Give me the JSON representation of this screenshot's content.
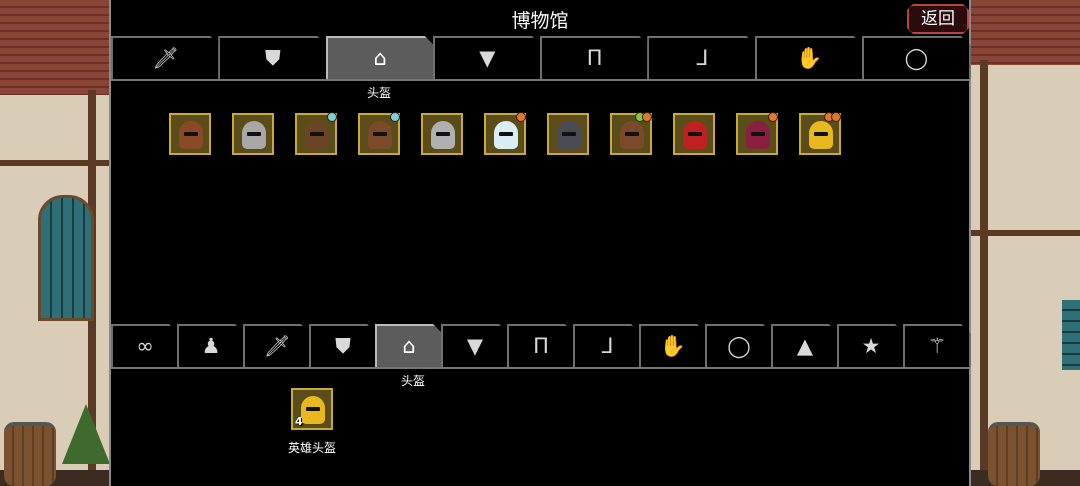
{
  "window": {
    "title": "博物馆",
    "back_label": "返回"
  },
  "top_tabs": {
    "tabs": [
      {
        "icon": "sword-icon",
        "glyph": "🗡"
      },
      {
        "icon": "shield-icon",
        "glyph": "⛊"
      },
      {
        "icon": "helmet-icon",
        "glyph": "⌂"
      },
      {
        "icon": "armor-icon",
        "glyph": "▼"
      },
      {
        "icon": "pants-icon",
        "glyph": "Π"
      },
      {
        "icon": "boots-icon",
        "glyph": "ᒧ"
      },
      {
        "icon": "glove-icon",
        "glyph": "✋"
      },
      {
        "icon": "ring-icon",
        "glyph": "◯"
      }
    ],
    "active_caption": "头盔"
  },
  "collection": {
    "items": [
      {
        "name": "leather-cap",
        "color": "#8a4a28",
        "badges": []
      },
      {
        "name": "iron-visor-helm",
        "color": "#a8a8a8",
        "badges": []
      },
      {
        "name": "bronze-horned-helm",
        "color": "#6b4426",
        "badges": [
          "#7ad0e0"
        ]
      },
      {
        "name": "fur-hood",
        "color": "#7a4a2a",
        "badges": [
          "#7ad0e0"
        ]
      },
      {
        "name": "steel-great-helm",
        "color": "#b0b0b0",
        "badges": []
      },
      {
        "name": "frost-helm",
        "color": "#d8eef2",
        "badges": [
          "#e07a2a"
        ]
      },
      {
        "name": "dark-hood",
        "color": "#4a4a55",
        "badges": []
      },
      {
        "name": "horned-leather-helm",
        "color": "#7a4a2a",
        "badges": [
          "#7acc3a",
          "#e07a2a"
        ]
      },
      {
        "name": "crimson-helm",
        "color": "#c02020",
        "badges": []
      },
      {
        "name": "purple-hood",
        "color": "#8a2040",
        "badges": [
          "#e07a2a"
        ]
      },
      {
        "name": "golden-helm",
        "color": "#e8b820",
        "badges": [
          "#e07a2a",
          "#e07a2a"
        ]
      }
    ]
  },
  "bottom_tabs": {
    "tabs": [
      {
        "icon": "infinity-icon",
        "glyph": "∞"
      },
      {
        "icon": "potion-icon",
        "glyph": "♟"
      },
      {
        "icon": "sword-icon",
        "glyph": "🗡"
      },
      {
        "icon": "shield-icon",
        "glyph": "⛊"
      },
      {
        "icon": "helmet-icon",
        "glyph": "⌂"
      },
      {
        "icon": "armor-icon",
        "glyph": "▼"
      },
      {
        "icon": "pants-icon",
        "glyph": "Π"
      },
      {
        "icon": "boots-icon",
        "glyph": "ᒧ"
      },
      {
        "icon": "glove-icon",
        "glyph": "✋"
      },
      {
        "icon": "ring-icon",
        "glyph": "◯"
      },
      {
        "icon": "pile-icon",
        "glyph": "▲"
      },
      {
        "icon": "star-icon",
        "glyph": "★"
      },
      {
        "icon": "wand-icon",
        "glyph": "⚚"
      }
    ],
    "active_caption": "头盔"
  },
  "inventory": {
    "items": [
      {
        "name": "hero-helmet",
        "label": "英雄头盔",
        "count": "4",
        "color": "#e8b820"
      }
    ]
  }
}
